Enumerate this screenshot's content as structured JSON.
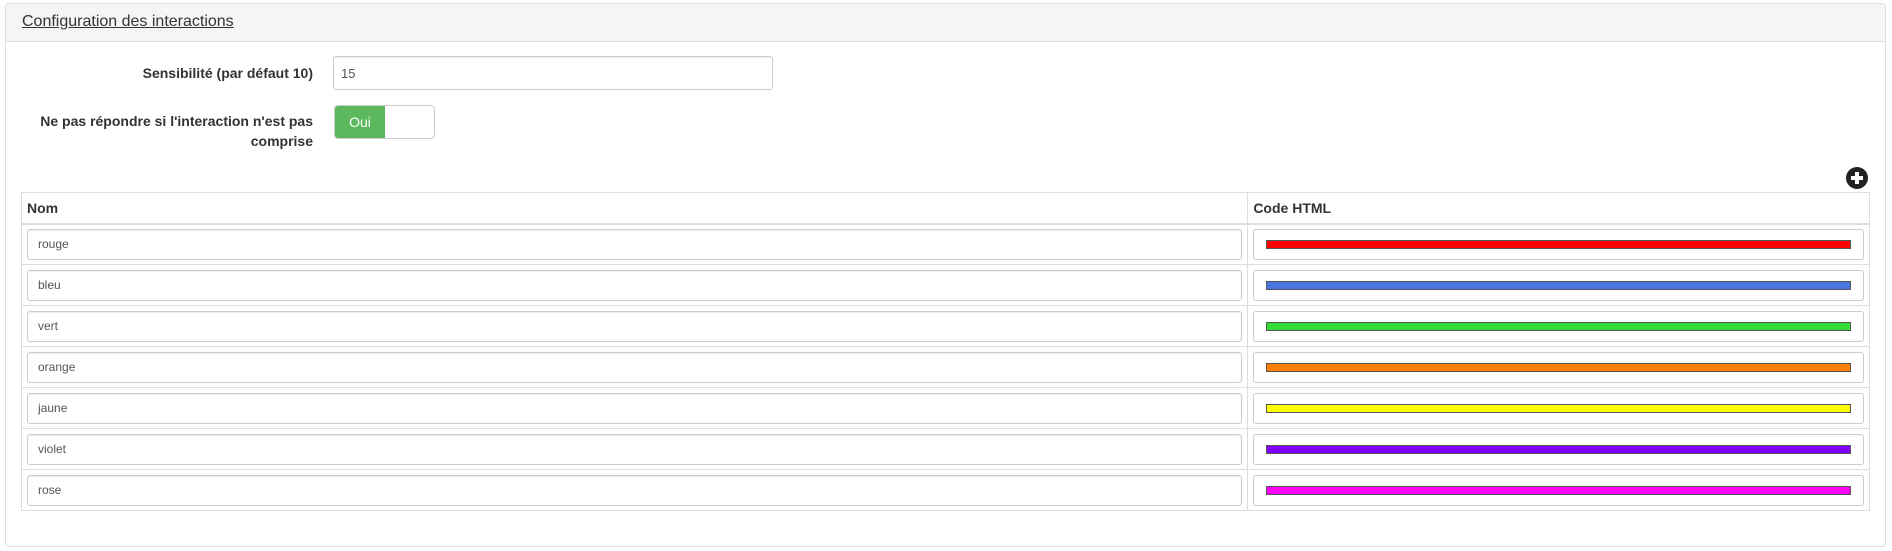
{
  "panel": {
    "title": "Configuration des interactions"
  },
  "form": {
    "sensitivity": {
      "label": "Sensibilité (par défaut 10)",
      "value": "15"
    },
    "no_answer": {
      "label_line1": "Ne pas répondre si l'interaction n'est pas",
      "label_line2": "comprise",
      "toggle_on_label": "Oui",
      "checked": true,
      "on_color": "#5cb85c"
    }
  },
  "add_button": {
    "icon": "plus-circle-icon"
  },
  "table": {
    "headers": {
      "name": "Nom",
      "code": "Code HTML"
    },
    "rows": [
      {
        "name": "rouge",
        "color": "#ff0000"
      },
      {
        "name": "bleu",
        "color": "#4a76e0"
      },
      {
        "name": "vert",
        "color": "#33dd33"
      },
      {
        "name": "orange",
        "color": "#ff7f00"
      },
      {
        "name": "jaune",
        "color": "#ffff00"
      },
      {
        "name": "violet",
        "color": "#7f00ff"
      },
      {
        "name": "rose",
        "color": "#ff00ff"
      }
    ]
  }
}
